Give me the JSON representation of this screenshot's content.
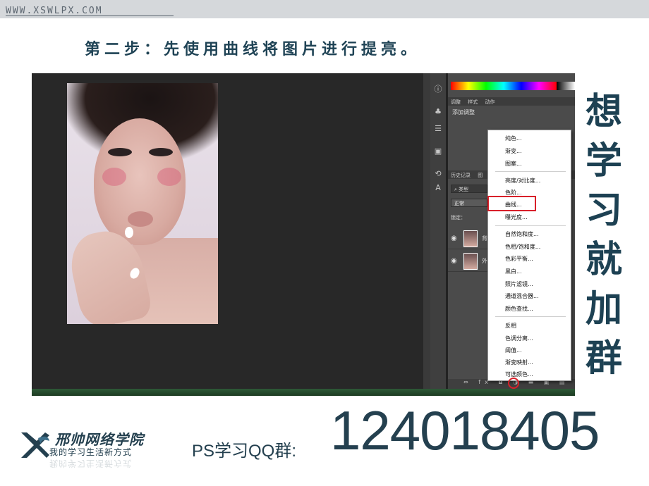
{
  "header": {
    "site_url": "WWW.XSWLPX.COM",
    "step_title": "第二步：先使用曲线将图片进行提亮。"
  },
  "photoshop": {
    "panel_tabs": [
      "调整",
      "样式",
      "动作"
    ],
    "add_adjustment_label": "添加调整",
    "history_tabs": [
      "历史记录",
      "图"
    ],
    "filter_kind": "类型",
    "blend_mode": "正常",
    "lock_label": "锁定：",
    "layers": [
      {
        "name": "背"
      },
      {
        "name": "外"
      }
    ],
    "bottom_icons": "⇔ fx ◘ ◑ ▬ ▣ ▤",
    "adjustment_menu": [
      {
        "label": "纯色..."
      },
      {
        "label": "渐变..."
      },
      {
        "label": "图案..."
      },
      {
        "label": "亮度/对比度..."
      },
      {
        "label": "色阶..."
      },
      {
        "label": "曲线...",
        "highlighted": true
      },
      {
        "label": "曝光度..."
      },
      {
        "label": "自然饱和度..."
      },
      {
        "label": "色相/饱和度..."
      },
      {
        "label": "色彩平衡..."
      },
      {
        "label": "黑白..."
      },
      {
        "label": "照片滤镜..."
      },
      {
        "label": "通道混合器..."
      },
      {
        "label": "颜色查找..."
      },
      {
        "label": "反相"
      },
      {
        "label": "色调分离..."
      },
      {
        "label": "阈值..."
      },
      {
        "label": "渐变映射..."
      },
      {
        "label": "可选颜色..."
      }
    ],
    "highlight_color": "#d8202a"
  },
  "side_slogan": [
    "想",
    "学",
    "习",
    "就",
    "加",
    "群"
  ],
  "footer": {
    "logo_name": "邢帅网络学院",
    "logo_slogan": "我的学习生活新方式",
    "qq_label": "PS学习QQ群:",
    "qq_number": "124018405"
  },
  "colors": {
    "brand": "#24404f",
    "topbar": "#d5d8db"
  }
}
